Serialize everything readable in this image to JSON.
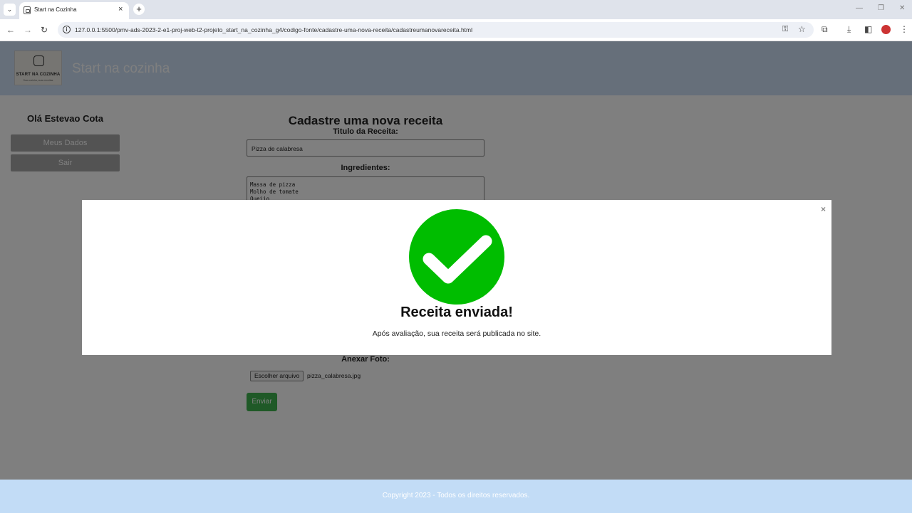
{
  "browser": {
    "tab_title": "Start na Cozinha",
    "tab_close": "×",
    "new_tab": "+",
    "url": "127.0.0.1:5500/pmv-ads-2023-2-e1-proj-web-t2-projeto_start_na_cozinha_g4/codigo-fonte/cadastre-uma-nova-receita/cadastreumanovareceita.html"
  },
  "header": {
    "logo_text": "START NA COZINHA",
    "logo_sub": "Sua cozinha, suas receitas",
    "site_title": "Start na cozinha"
  },
  "sidebar": {
    "greeting": "Olá Estevao Cota",
    "buttons": [
      {
        "label": "Meus Dados"
      },
      {
        "label": "Sair"
      }
    ]
  },
  "form": {
    "title": "Cadastre uma nova receita",
    "recipe_title_label": "Titulo da Receita:",
    "recipe_title_value": "Pizza de calabresa",
    "ingredients_label": "Ingredientes:",
    "ingredients_value": "Massa de pizza\nMolho de tomate\nQueijo",
    "photo_label": "Anexar Foto:",
    "file_button": "Escolher arquivo",
    "file_name": "pizza_calabresa.jpg",
    "submit": "Enviar"
  },
  "footer": {
    "text": "Copyright 2023 - Todos os direitos reservados."
  },
  "modal": {
    "close": "×",
    "title": "Receita enviada!",
    "message": "Após avaliação, sua receita será publicada no site.",
    "icon": "check-circle-icon",
    "icon_color": "#00bd00"
  },
  "colors": {
    "header_bg": "#ccdff4",
    "footer_bg": "#c2dcf6",
    "submit_bg": "#3fb34f",
    "overlay": "rgba(0,0,0,0.5)"
  }
}
